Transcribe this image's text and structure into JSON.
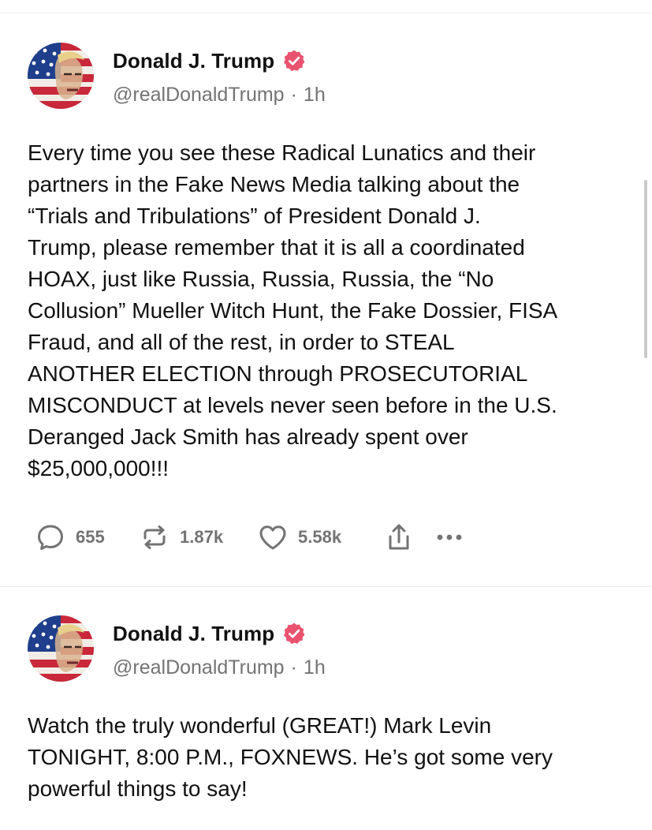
{
  "posts": [
    {
      "display_name": "Donald J. Trump",
      "handle": "@realDonaldTrump",
      "separator": "·",
      "time": "1h",
      "body": "Every time you see these Radical Lunatics and their\npartners in the Fake News Media talking about the\n“Trials and Tribulations” of President Donald J.\nTrump, please remember that it is all a coordinated\nHOAX, just like Russia, Russia, Russia, the “No\nCollusion” Mueller Witch Hunt, the Fake Dossier, FISA\nFraud, and all of the rest, in order to STEAL\nANOTHER ELECTION through PROSECUTORIAL\nMISCONDUCT at levels never seen before in the U.S.\nDeranged Jack Smith has already spent over\n$25,000,000!!!",
      "replies": "655",
      "reposts": "1.87k",
      "likes": "5.58k"
    },
    {
      "display_name": "Donald J. Trump",
      "handle": "@realDonaldTrump",
      "separator": "·",
      "time": "1h",
      "body": "Watch the truly wonderful (GREAT!) Mark Levin\nTONIGHT, 8:00 P.M., FOXNEWS. He’s got some very\npowerful things to say!"
    }
  ],
  "icons": {
    "reply": "speech-bubble-icon",
    "repost": "repost-arrows-icon",
    "like": "heart-icon",
    "share": "share-upload-icon",
    "more": "more-dots-icon",
    "verified": "verified-badge-icon"
  },
  "colors": {
    "verified_badge": "#e9536f",
    "secondary_text": "#737373",
    "primary_text": "#111111",
    "divider": "#ececec"
  }
}
